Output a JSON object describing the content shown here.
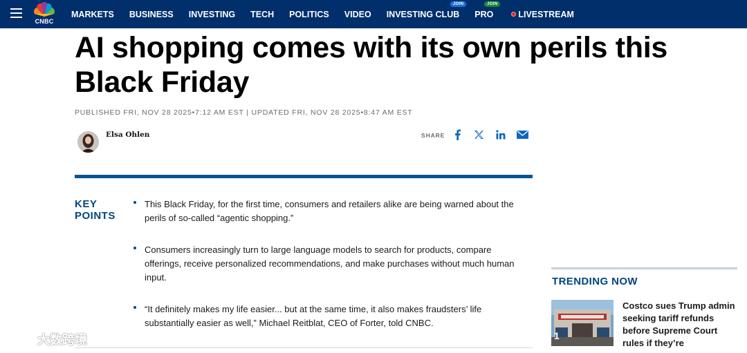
{
  "nav": {
    "logo": "CNBC",
    "items": [
      {
        "label": "MARKETS"
      },
      {
        "label": "BUSINESS"
      },
      {
        "label": "INVESTING"
      },
      {
        "label": "TECH"
      },
      {
        "label": "POLITICS"
      },
      {
        "label": "VIDEO"
      },
      {
        "label": "INVESTING CLUB",
        "badge": "JOIN"
      },
      {
        "label": "PRO",
        "badge": "JOIN"
      },
      {
        "label": "LIVESTREAM"
      }
    ]
  },
  "article": {
    "headline": "AI shopping comes with its own perils this Black Friday",
    "dateline": "Published Fri, Nov 28 2025•7:12 AM EST | Updated Fri, Nov 28 2025•8:47 AM EST",
    "author": "Elsa Ohlen",
    "share_label": "SHARE",
    "share_icons": [
      "facebook-icon",
      "x-icon",
      "linkedin-icon",
      "email-icon"
    ],
    "key_points_title": "KEY POINTS",
    "key_points": [
      "This Black Friday, for the first time, consumers and retailers alike are being warned about the perils of so-called “agentic shopping.”",
      "Consumers increasingly turn to large language models to search for products, compare offerings, receive personalized recommendations, and make purchases without much human input.",
      "“It definitely makes my life easier... but at the same time, it also makes fraudsters’ life substantially easier as well,” Michael Reitblat, CEO of Forter, told CNBC."
    ]
  },
  "trending": {
    "title": "TRENDING NOW",
    "items": [
      {
        "rank": "1",
        "text": "Costco sues Trump admin seeking tariff refunds before Supreme Court rules if they’re"
      }
    ]
  },
  "watermark": {
    "text": "大数跨境"
  },
  "colors": {
    "nav_bg": "#002f6c",
    "accent": "#00457c",
    "divider": "#005594"
  }
}
